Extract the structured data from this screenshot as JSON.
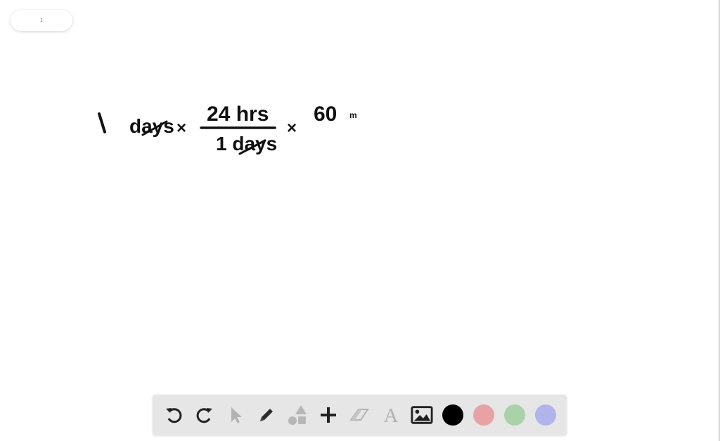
{
  "page_indicator": {
    "label": "1"
  },
  "whiteboard": {
    "handwriting": {
      "term1_number": "1",
      "term1_unit": "days",
      "times1": "×",
      "fraction_numerator": "24 hrs",
      "fraction_denominator": "1 days",
      "times2": "×",
      "term3_number": "60",
      "term3_unit": "m"
    }
  },
  "toolbar": {
    "tools": [
      {
        "name": "undo-icon",
        "enabled": true
      },
      {
        "name": "redo-icon",
        "enabled": true
      },
      {
        "name": "pointer-icon",
        "enabled": false
      },
      {
        "name": "pencil-icon",
        "enabled": true
      },
      {
        "name": "shapes-icon",
        "enabled": false
      },
      {
        "name": "plus-icon",
        "enabled": true
      },
      {
        "name": "eraser-icon",
        "enabled": false
      },
      {
        "name": "text-icon",
        "enabled": false
      },
      {
        "name": "image-icon",
        "enabled": true
      }
    ],
    "colors": {
      "black": "#000000",
      "pink": "#e8a1a4",
      "green": "#a9d2a9",
      "lavender": "#b1b4ea"
    }
  }
}
